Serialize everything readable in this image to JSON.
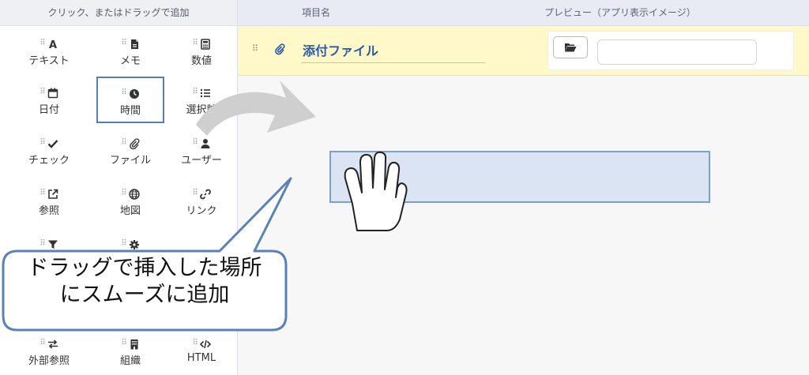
{
  "palette": {
    "header": "クリック、またはドラッグで追加",
    "items": [
      {
        "label": "テキスト",
        "icon": "font-letter-icon"
      },
      {
        "label": "メモ",
        "icon": "memo-icon"
      },
      {
        "label": "数値",
        "icon": "calculator-icon"
      },
      {
        "label": "日付",
        "icon": "calendar-icon"
      },
      {
        "label": "時間",
        "icon": "clock-icon"
      },
      {
        "label": "選択肢",
        "icon": "list-icon"
      },
      {
        "label": "チェック",
        "icon": "check-icon"
      },
      {
        "label": "ファイル",
        "icon": "paperclip-icon"
      },
      {
        "label": "ユーザー",
        "icon": "user-icon"
      },
      {
        "label": "参照",
        "icon": "external-link-icon"
      },
      {
        "label": "地図",
        "icon": "globe-icon"
      },
      {
        "label": "リンク",
        "icon": "link-icon"
      },
      {
        "label": "外部参照",
        "icon": "swap-arrows-icon"
      },
      {
        "label": "組織",
        "icon": "building-icon"
      },
      {
        "label": "HTML",
        "icon": "code-icon"
      }
    ]
  },
  "editor": {
    "col_name": "項目名",
    "col_preview": "プレビュー（アプリ表示イメージ）",
    "field_row": {
      "name_value": "添付ファイル",
      "icon": "paperclip-icon",
      "preview_button_icon": "folder-open-icon"
    }
  },
  "callout": {
    "line1": "ドラッグで挿入した場所",
    "line2": "にスムーズに追加"
  },
  "colors": {
    "accent": "#2c5aa6",
    "selected_border": "#5a7fa8",
    "row_highlight": "#fff8c8",
    "drop_target": "#dbe4f2",
    "callout_border": "#5b82b5"
  }
}
